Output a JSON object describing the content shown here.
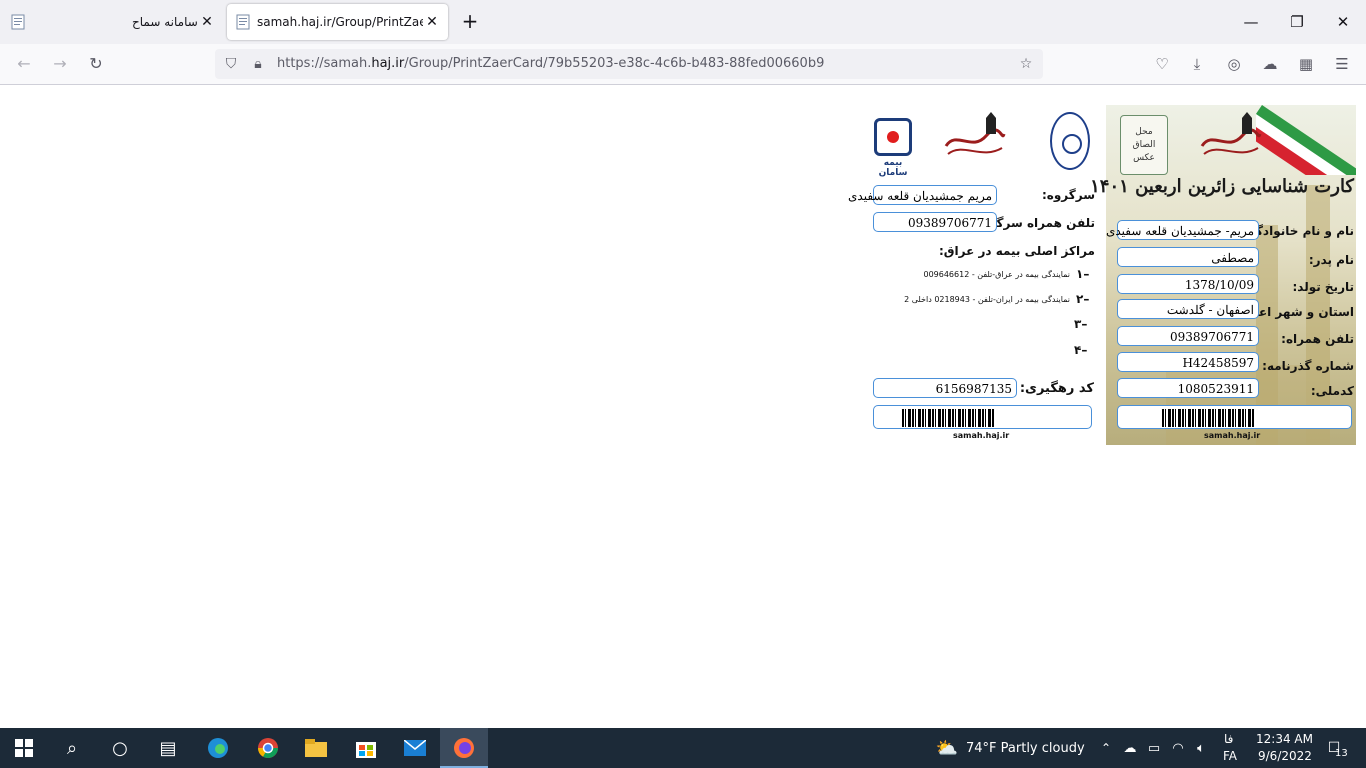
{
  "browser": {
    "tabs": [
      {
        "title": "سامانه سماح",
        "active": false
      },
      {
        "title": "samah.haj.ir/Group/PrintZaerCa",
        "active": true
      }
    ],
    "url_prefix": "https://samah.",
    "url_domain": "haj.ir",
    "url_path": "/Group/PrintZaerCard/79b55203-e38c-4c6b-b483-88fed00660b9"
  },
  "card": {
    "photo": {
      "line1": "محل",
      "line2": "الصاق",
      "line3": "عکس"
    },
    "logo_text": "لبیک یا حسین",
    "title": "کارت شناسایی زائرین اربعین ۱۴۰۱",
    "fields": [
      {
        "label": "نام و نام خانوادگی:",
        "value": "مریم- جمشیدیان قلعه سفیدی"
      },
      {
        "label": "نام پدر:",
        "value": "مصطفی"
      },
      {
        "label": "تاریخ تولد:",
        "value": "1378/10/09"
      },
      {
        "label": "استان و شهر اعزام:",
        "value": "اصفهان - گلدشت"
      },
      {
        "label": "تلفن همراه:",
        "value": "09389706771"
      },
      {
        "label": "شماره گذرنامه:",
        "value": "H42458597"
      },
      {
        "label": "کدملی:",
        "value": "1080523911"
      }
    ],
    "site": "samah.haj.ir"
  },
  "back": {
    "saman_label": "بیمه سامان",
    "leader_label": "سرگروه:",
    "leader_value": "مریم جمشیدیان قلعه سفیدی",
    "leader_phone_label": "تلفن همراه سرگروه:",
    "leader_phone_value": "09389706771",
    "insurance_title": "مراکز اصلی بیمه در عراق:",
    "items": [
      {
        "num": "۱–",
        "text": "نمایندگی بیمه در عراق-تلفن - 009646612"
      },
      {
        "num": "۲–",
        "text": "نمایندگی بیمه در ایران-تلفن - 0218943 داخلی 2"
      },
      {
        "num": "۳–",
        "text": ""
      },
      {
        "num": "۴–",
        "text": ""
      }
    ],
    "tracking_label": "کد رهگیری:",
    "tracking_value": "6156987135",
    "site": "samah.haj.ir"
  },
  "taskbar": {
    "weather": "74°F  Partly cloudy",
    "lang_top": "فا",
    "lang_bottom": "FA",
    "time": "12:34 AM",
    "date": "9/6/2022",
    "notifications": "13"
  }
}
